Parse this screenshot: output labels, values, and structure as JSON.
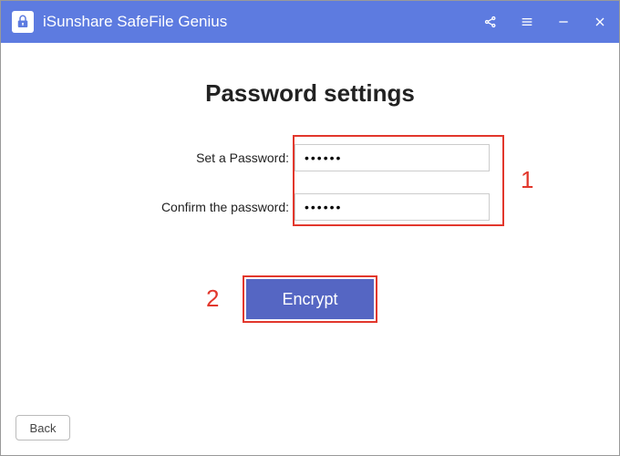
{
  "titlebar": {
    "app_name": "iSunshare SafeFile Genius"
  },
  "page": {
    "title": "Password settings"
  },
  "form": {
    "set_pw_label": "Set a Password:",
    "confirm_pw_label": "Confirm the password:",
    "set_pw_value": "••••••",
    "confirm_pw_value": "••••••"
  },
  "buttons": {
    "encrypt": "Encrypt",
    "back": "Back"
  },
  "annotations": {
    "one": "1",
    "two": "2"
  },
  "colors": {
    "brand": "#5d7be0",
    "highlight": "#e2372c"
  }
}
